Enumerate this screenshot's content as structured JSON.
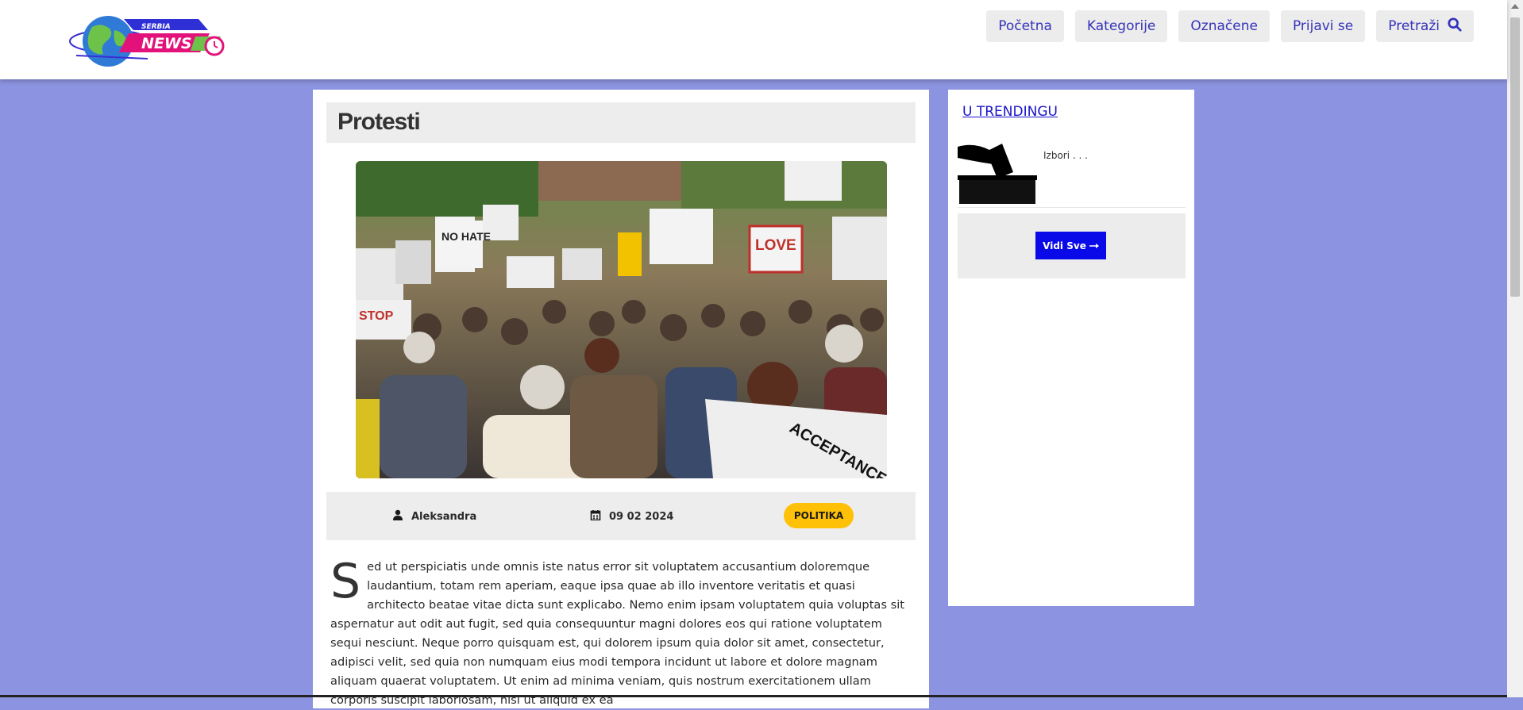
{
  "brand": {
    "logo_top_text": "SERBIA",
    "logo_main_text": "NEWS"
  },
  "nav": {
    "home": "Početna",
    "categories": "Kategorije",
    "tagged": "Označene",
    "login": "Prijavi se",
    "search": "Pretraži"
  },
  "article": {
    "title": "Protesti",
    "author": "Aleksandra",
    "date": "09 02 2024",
    "category": "POLITIKA",
    "dropcap": "S",
    "body": "ed ut perspiciatis unde omnis iste natus error sit voluptatem accusantium doloremque laudantium, totam rem aperiam, eaque ipsa quae ab illo inventore veritatis et quasi architecto beatae vitae dicta sunt explicabo. Nemo enim ipsam voluptatem quia voluptas sit aspernatur aut odit aut fugit, sed quia consequuntur magni dolores eos qui ratione voluptatem sequi nesciunt. Neque porro quisquam est, qui dolorem ipsum quia dolor sit amet, consectetur, adipisci velit, sed quia non numquam eius modi tempora incidunt ut labore et dolore magnam aliquam quaerat voluptatem. Ut enim ad minima veniam, quis nostrum exercitationem ullam corporis suscipit laboriosam, nisi ut aliquid ex ea",
    "hero_sign_texts": [
      "NO HATE",
      "LOVE",
      "STOP",
      "ACCEPTANCE"
    ]
  },
  "sidebar": {
    "heading": "U TRENDINGU",
    "items": [
      {
        "label": "Izbori . . ."
      }
    ],
    "view_all": "Vidi Sve"
  },
  "colors": {
    "page_bg": "#8c93e0",
    "nav_text": "#3533b9",
    "link": "#1a14c9",
    "badge": "#ffc107",
    "button": "#0a0ae8"
  },
  "icons": {
    "search": "search-icon",
    "author": "user-icon",
    "date": "calendar-icon",
    "view_all": "arrow-right-icon"
  }
}
